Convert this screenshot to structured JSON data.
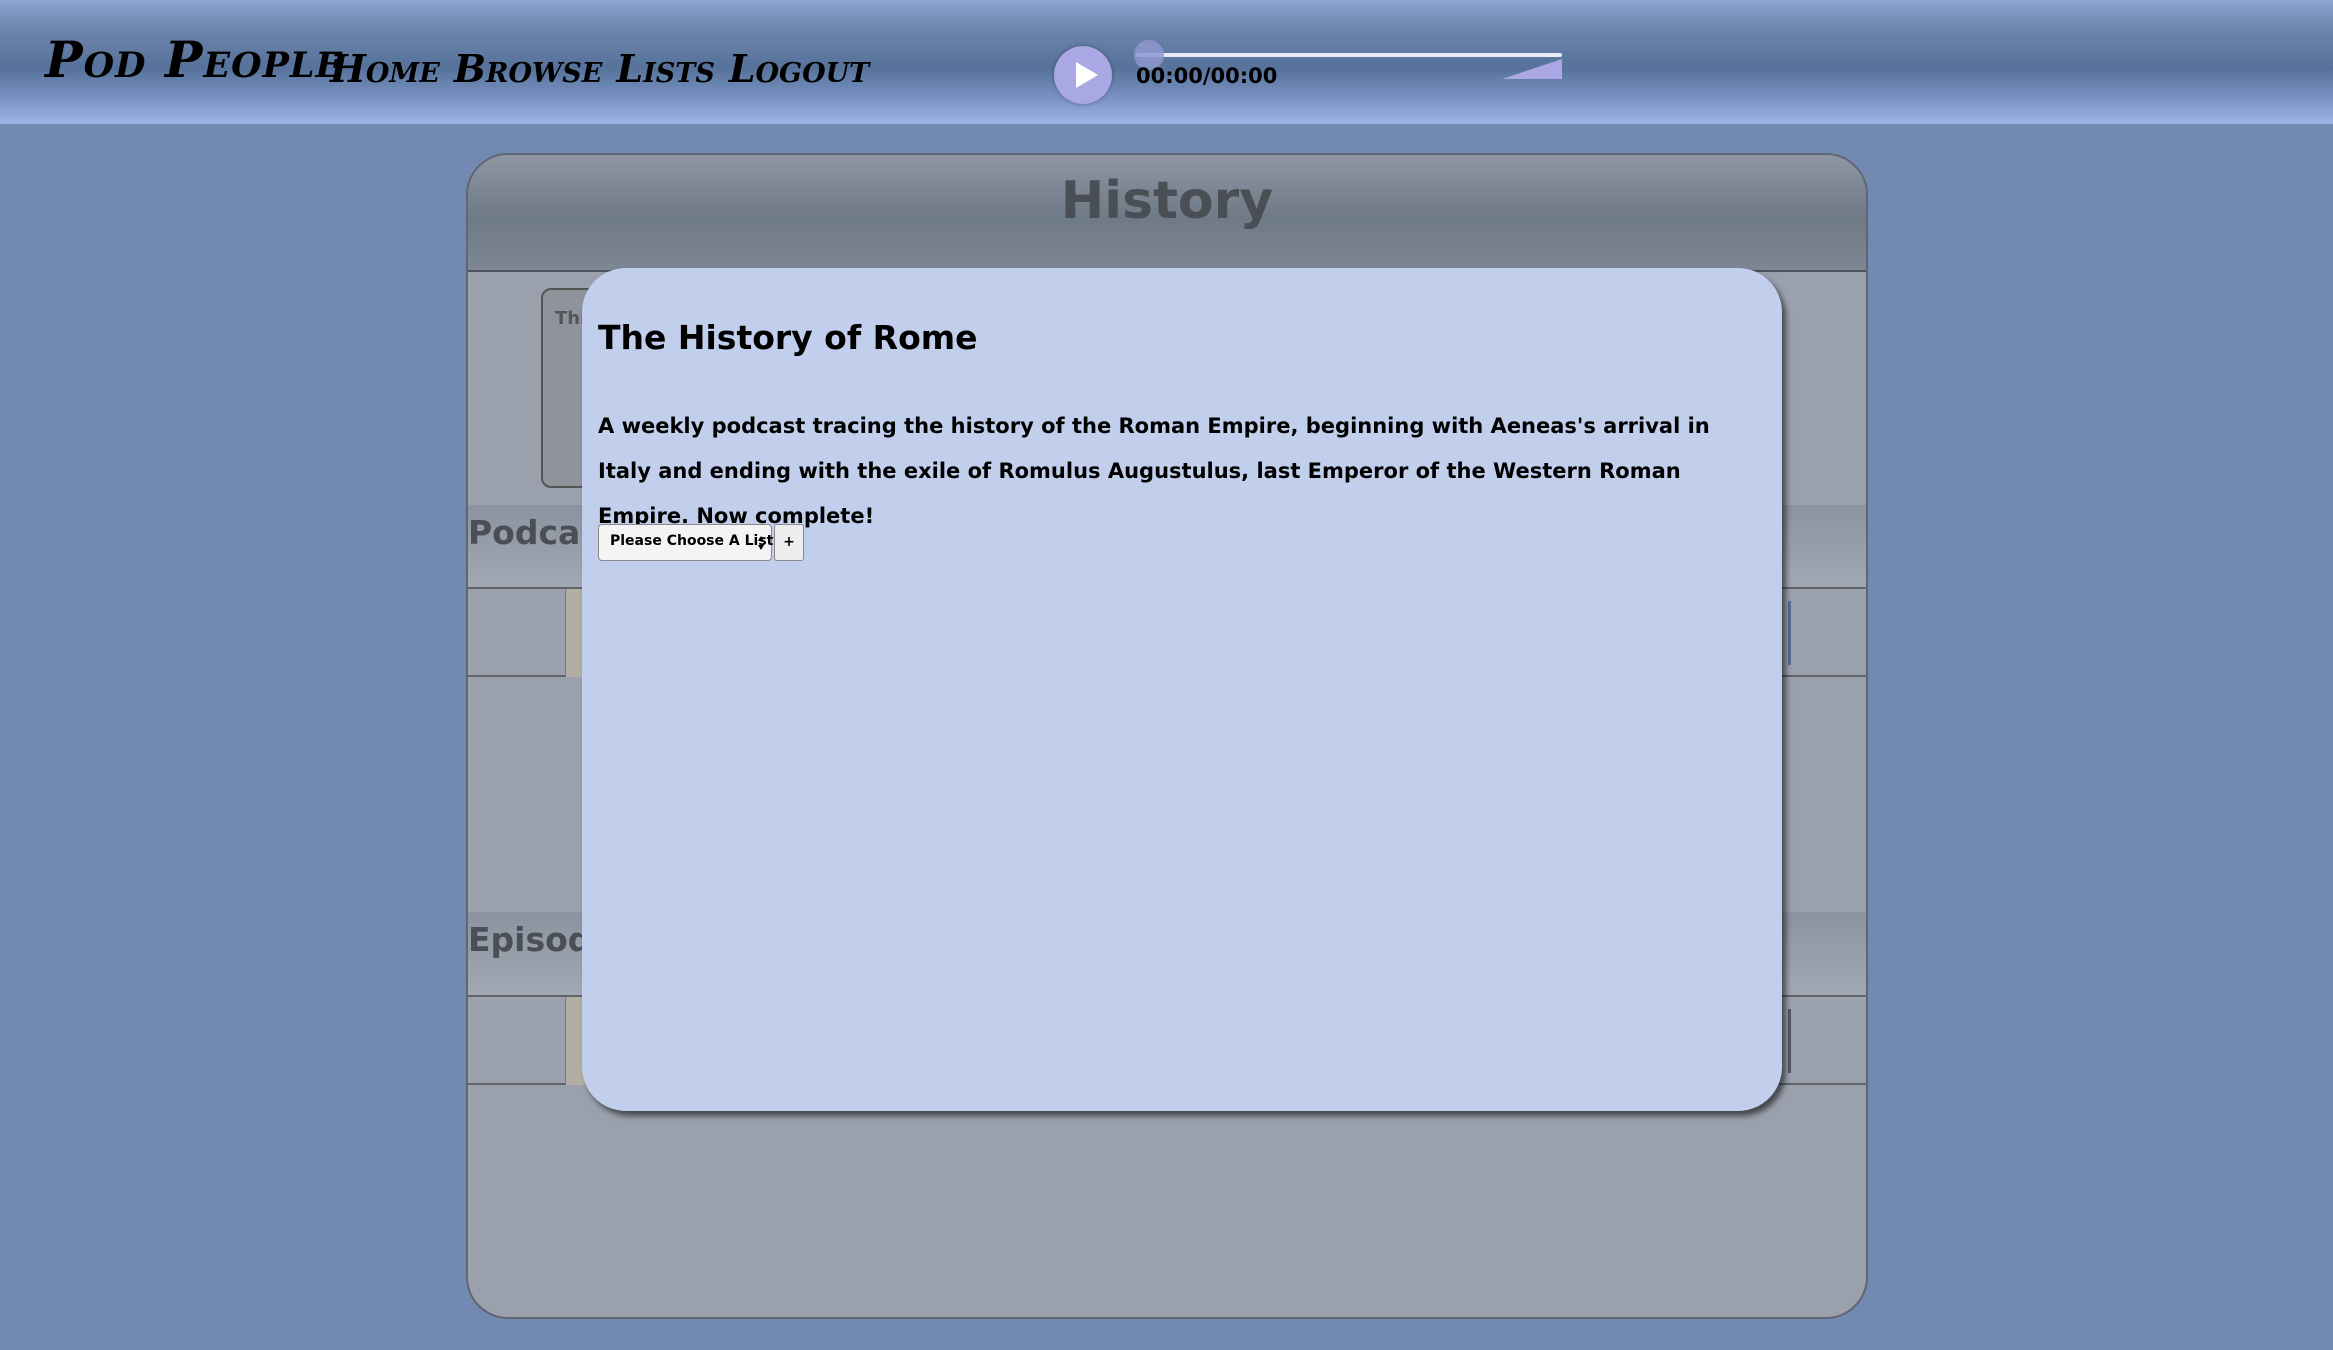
{
  "header": {
    "brand": "Pod People",
    "nav": [
      {
        "label": "Home"
      },
      {
        "label": "Browse"
      },
      {
        "label": "Lists"
      },
      {
        "label": "Logout"
      }
    ]
  },
  "player": {
    "time": "00:00/00:00",
    "progress": 0,
    "play_icon": "play-icon"
  },
  "page": {
    "title": "History",
    "feature_card_label": "Thi",
    "sections": [
      {
        "label": "Podcast"
      },
      {
        "label": "Episode"
      }
    ]
  },
  "modal": {
    "title": "The History of Rome",
    "description": "A weekly podcast tracing the history of the Roman Empire, beginning with Aeneas's arrival in Italy and ending with the exile of Romulus Augustulus, last Emperor of the Western Roman Empire. Now complete!",
    "list_select": {
      "selected": "Please Choose A List"
    },
    "add_button": "+"
  },
  "colors": {
    "background": "#7289b1",
    "modal_bg": "#c1cfec",
    "accent": "#a9a8e4"
  }
}
